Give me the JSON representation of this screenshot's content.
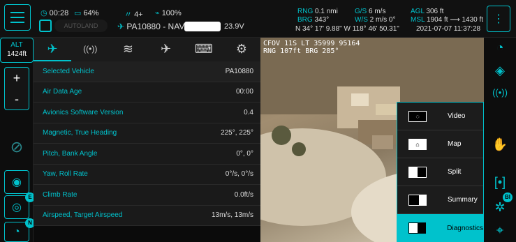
{
  "status": {
    "time": "00:28",
    "battery_pct": "64%",
    "signal": "4+",
    "link": "100%",
    "autoland": "AUTOLAND",
    "vehicle": "PA10880 - NAV",
    "voltage": "23.9V"
  },
  "telemetry": {
    "rng_label": "RNG",
    "rng": "0.1 nmi",
    "brg_label": "BRG",
    "brg": "343°",
    "gs_label": "G/S",
    "gs": "6 m/s",
    "ws_label": "W/S",
    "ws": "2 m/s  0°",
    "agl_label": "AGL",
    "agl": "306 ft",
    "msl_label": "MSL",
    "msl": "1904 ft  ⟶  1430 ft",
    "coords": "N 34° 17' 9.88\"  W 118° 46' 50.31\"",
    "datetime": "2021-07-07 11:37:28"
  },
  "alt": {
    "label": "ALT",
    "value": "1424ft"
  },
  "zoom": {
    "plus": "+",
    "minus": "-"
  },
  "tabs": [
    {
      "icon": "aircraft-icon",
      "glyph": "✈"
    },
    {
      "icon": "radio-icon",
      "glyph": "((•))"
    },
    {
      "icon": "wind-icon",
      "glyph": "≋"
    },
    {
      "icon": "plane-icon",
      "glyph": "✈"
    },
    {
      "icon": "gamepad-icon",
      "glyph": "⌨"
    },
    {
      "icon": "gear-icon",
      "glyph": "⚙"
    }
  ],
  "diagnostics": [
    {
      "key": "Selected Vehicle",
      "value": "PA10880"
    },
    {
      "key": "Air Data Age",
      "value": "00:00"
    },
    {
      "key": "Avionics Software Version",
      "value": "0.4"
    },
    {
      "key": "Magnetic, True Heading",
      "value": "225°, 225°"
    },
    {
      "key": "Pitch, Bank Angle",
      "value": "0°, 0°"
    },
    {
      "key": "Yaw, Roll Rate",
      "value": "0°/s, 0°/s"
    },
    {
      "key": "Climb Rate",
      "value": "0.0ft/s"
    },
    {
      "key": "Airspeed, Target Airspeed",
      "value": "13m/s, 13m/s"
    }
  ],
  "video": {
    "line1": "CFOV 11S LT 35999 95164",
    "line2": "RNG 107ft BRG 285°"
  },
  "views": [
    {
      "label": "Video",
      "selected": false
    },
    {
      "label": "Map",
      "selected": false
    },
    {
      "label": "Split",
      "selected": false
    },
    {
      "label": "Summary",
      "selected": false
    },
    {
      "label": "Diagnostics",
      "selected": true
    }
  ],
  "badges": {
    "e": "E",
    "n": "N",
    "bi": "BI"
  },
  "colors": {
    "accent": "#00c2cc",
    "background": "#0b0b0b"
  }
}
